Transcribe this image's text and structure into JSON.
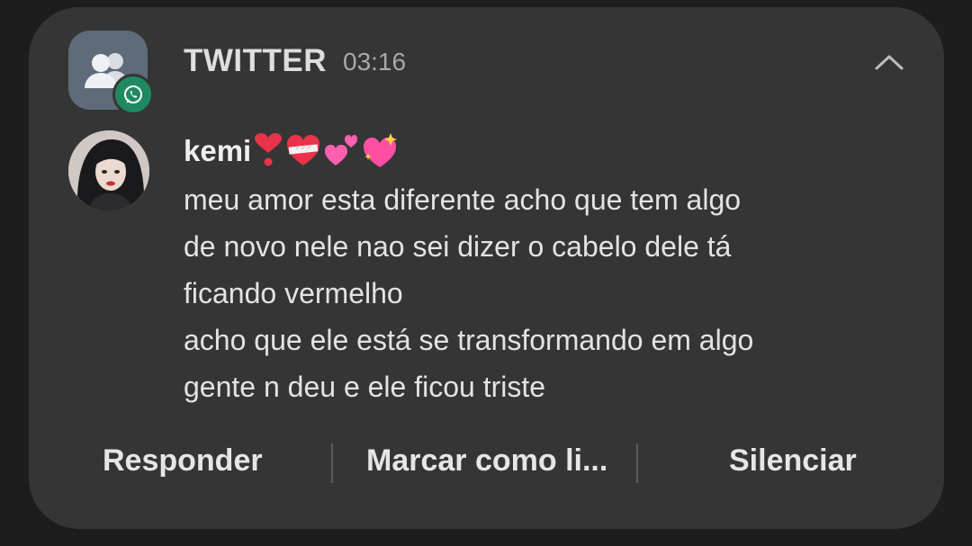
{
  "notification": {
    "app_name": "TWITTER",
    "time": "03:16",
    "app_icon": "group-people-icon",
    "badge_icon": "whatsapp-icon",
    "badge_color": "#1f8a61",
    "sender": "kemi",
    "sender_emojis": [
      "heart-exclamation",
      "mending-heart",
      "two-hearts",
      "sparkling-heart"
    ],
    "message_lines": [
      "meu amor esta diferente acho que tem algo",
      "de novo nele nao sei dizer o cabelo dele tá",
      "ficando vermelho",
      "acho que ele está se transformando em algo",
      "gente n deu e ele ficou triste"
    ]
  },
  "actions": {
    "reply": "Responder",
    "mark_read": "Marcar como li...",
    "mute": "Silenciar"
  },
  "colors": {
    "card_background": "#353535",
    "screen_background": "#1d1d1d",
    "heart_red": "#e8334a",
    "heart_pink": "#ff5fb0"
  }
}
